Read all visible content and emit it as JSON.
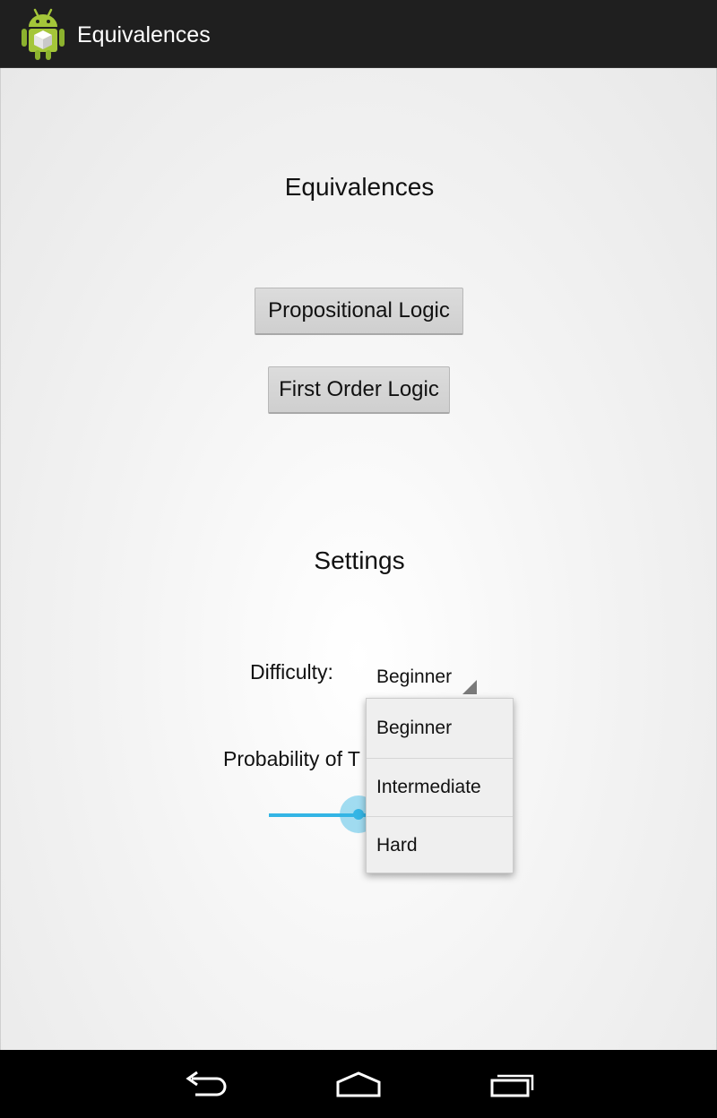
{
  "action_bar": {
    "title": "Equivalences",
    "icon": "android-robot-icon"
  },
  "main": {
    "heading": "Equivalences",
    "buttons": [
      {
        "label": "Propositional Logic"
      },
      {
        "label": "First Order Logic"
      }
    ]
  },
  "settings": {
    "heading": "Settings",
    "difficulty_label": "Difficulty:",
    "difficulty_value": "Beginner",
    "probability_label": "Probability of T",
    "probability_seek_fraction": 0.5
  },
  "dropdown": {
    "options": [
      "Beginner",
      "Intermediate",
      "Hard"
    ]
  },
  "nav_bar": {
    "icons": [
      "back-icon",
      "home-icon",
      "recents-icon"
    ]
  },
  "colors": {
    "action_bar": "#1f1f1f",
    "accent": "#33b5e5",
    "android_green": "#8cc63f"
  }
}
